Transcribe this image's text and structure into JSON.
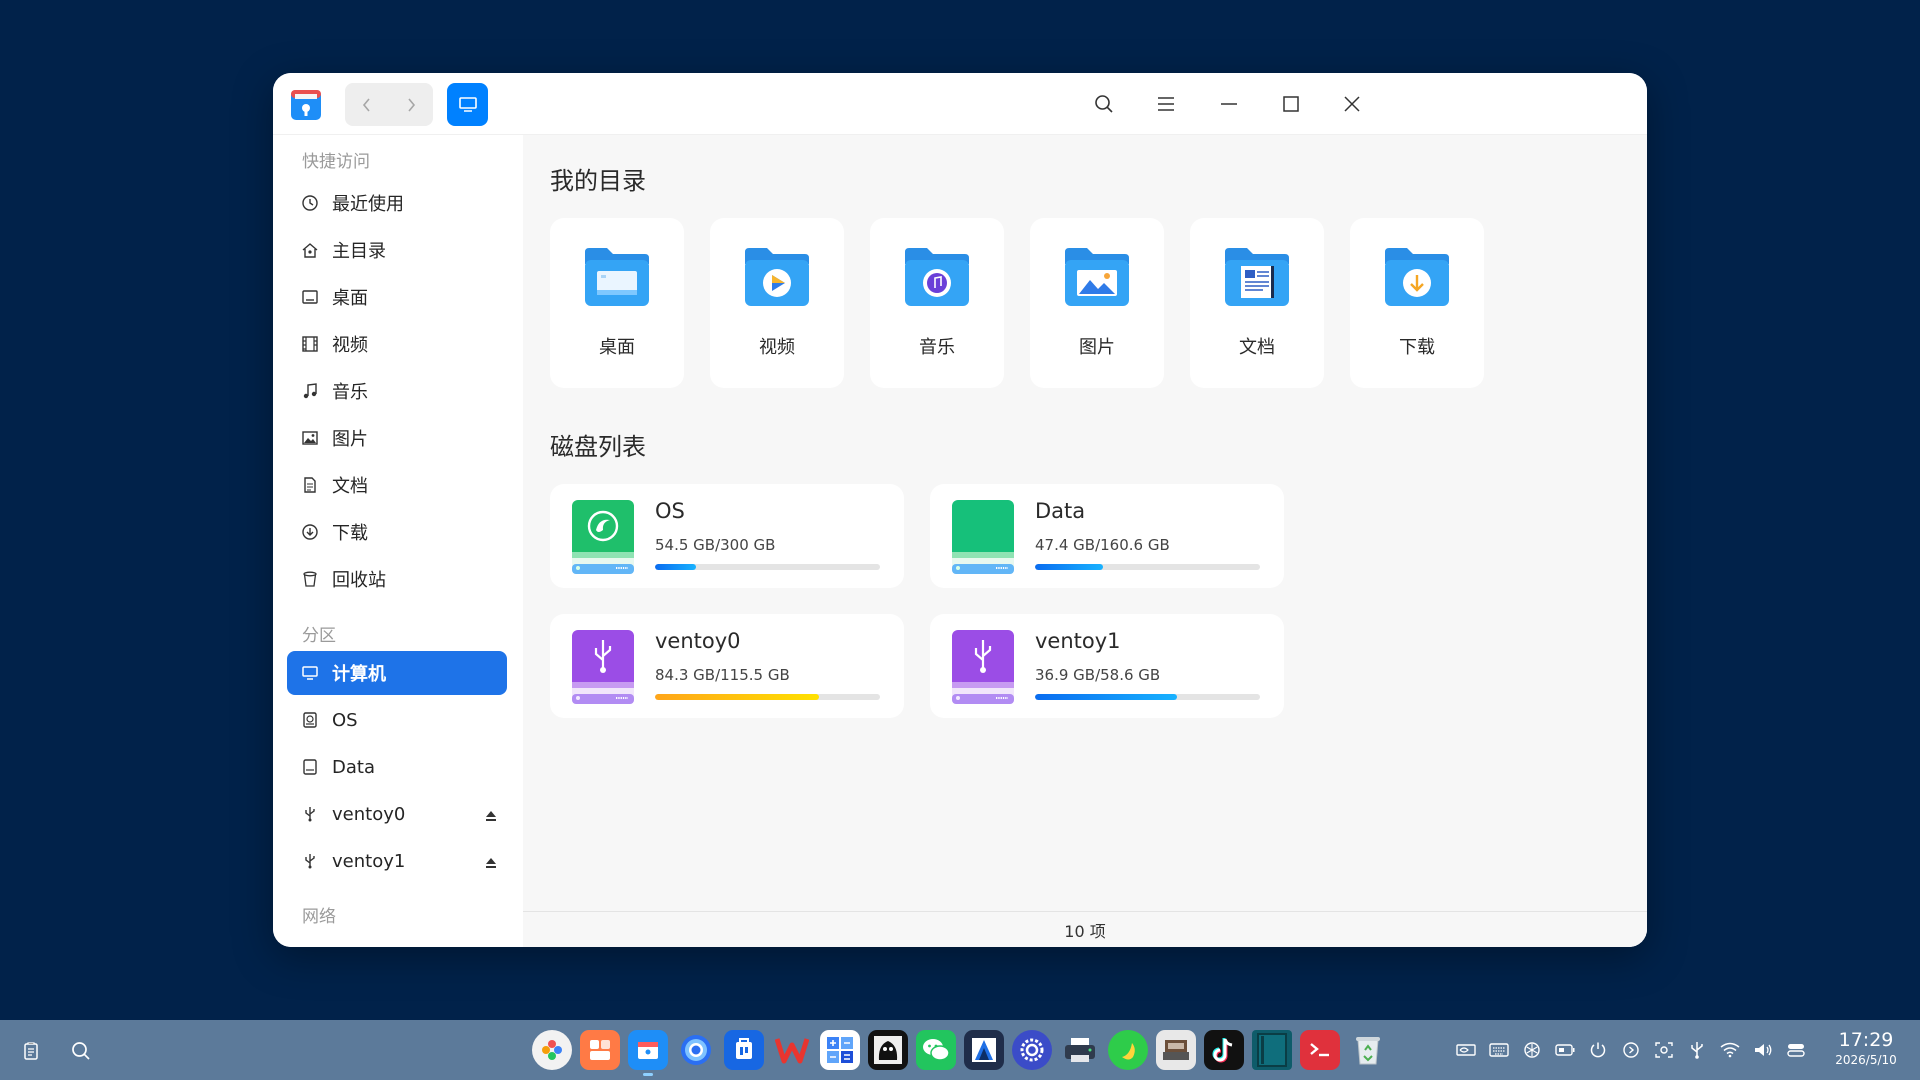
{
  "window": {
    "sidebar": {
      "groups": {
        "quick_access": "快捷访问",
        "partitions": "分区",
        "network": "网络"
      },
      "items": [
        {
          "label": "最近使用",
          "icon": "clock-icon"
        },
        {
          "label": "主目录",
          "icon": "home-icon"
        },
        {
          "label": "桌面",
          "icon": "desktop-icon"
        },
        {
          "label": "视频",
          "icon": "film-icon"
        },
        {
          "label": "音乐",
          "icon": "music-note-icon"
        },
        {
          "label": "图片",
          "icon": "picture-icon"
        },
        {
          "label": "文档",
          "icon": "document-icon"
        },
        {
          "label": "下载",
          "icon": "download-icon"
        },
        {
          "label": "回收站",
          "icon": "trash-icon"
        },
        {
          "label": "计算机",
          "icon": "computer-icon",
          "active": true
        },
        {
          "label": "OS",
          "icon": "disk-icon"
        },
        {
          "label": "Data",
          "icon": "drive-icon"
        },
        {
          "label": "ventoy0",
          "icon": "usb-icon",
          "ejectable": true
        },
        {
          "label": "ventoy1",
          "icon": "usb-icon",
          "ejectable": true
        }
      ]
    },
    "main": {
      "my_dirs_title": "我的目录",
      "dirs": [
        {
          "label": "桌面",
          "icon": "desktop-folder-icon"
        },
        {
          "label": "视频",
          "icon": "video-folder-icon"
        },
        {
          "label": "音乐",
          "icon": "music-folder-icon"
        },
        {
          "label": "图片",
          "icon": "pictures-folder-icon"
        },
        {
          "label": "文档",
          "icon": "documents-folder-icon"
        },
        {
          "label": "下载",
          "icon": "downloads-folder-icon"
        }
      ],
      "disks_title": "磁盘列表",
      "disks": [
        {
          "name": "OS",
          "size": "54.5 GB/300 GB",
          "used_fraction": 0.18,
          "kind": "system",
          "color": "#0c7cf2"
        },
        {
          "name": "Data",
          "size": "47.4 GB/160.6 GB",
          "used_fraction": 0.3,
          "kind": "data",
          "color": "#0c7cf2"
        },
        {
          "name": "ventoy0",
          "size": "84.3 GB/115.5 GB",
          "used_fraction": 0.73,
          "kind": "usb",
          "color": "#f5b800"
        },
        {
          "name": "ventoy1",
          "size": "36.9 GB/58.6 GB",
          "used_fraction": 0.63,
          "kind": "usb",
          "color": "#0c7cf2"
        }
      ],
      "status": "10 项"
    }
  },
  "taskbar": {
    "apps": [
      "launcher-icon",
      "multitasking-icon",
      "file-manager-icon",
      "browser-icon",
      "app-store-icon",
      "wps-icon",
      "calculator-icon",
      "gimp-icon",
      "wechat-icon",
      "drawing-icon",
      "settings-icon",
      "printer-icon",
      "qq-music-icon",
      "scanner-icon",
      "tiktok-icon",
      "reader-icon",
      "terminal-icon",
      "trash-icon"
    ],
    "clock": {
      "time": "17:29",
      "date": "2026/5/10"
    }
  }
}
